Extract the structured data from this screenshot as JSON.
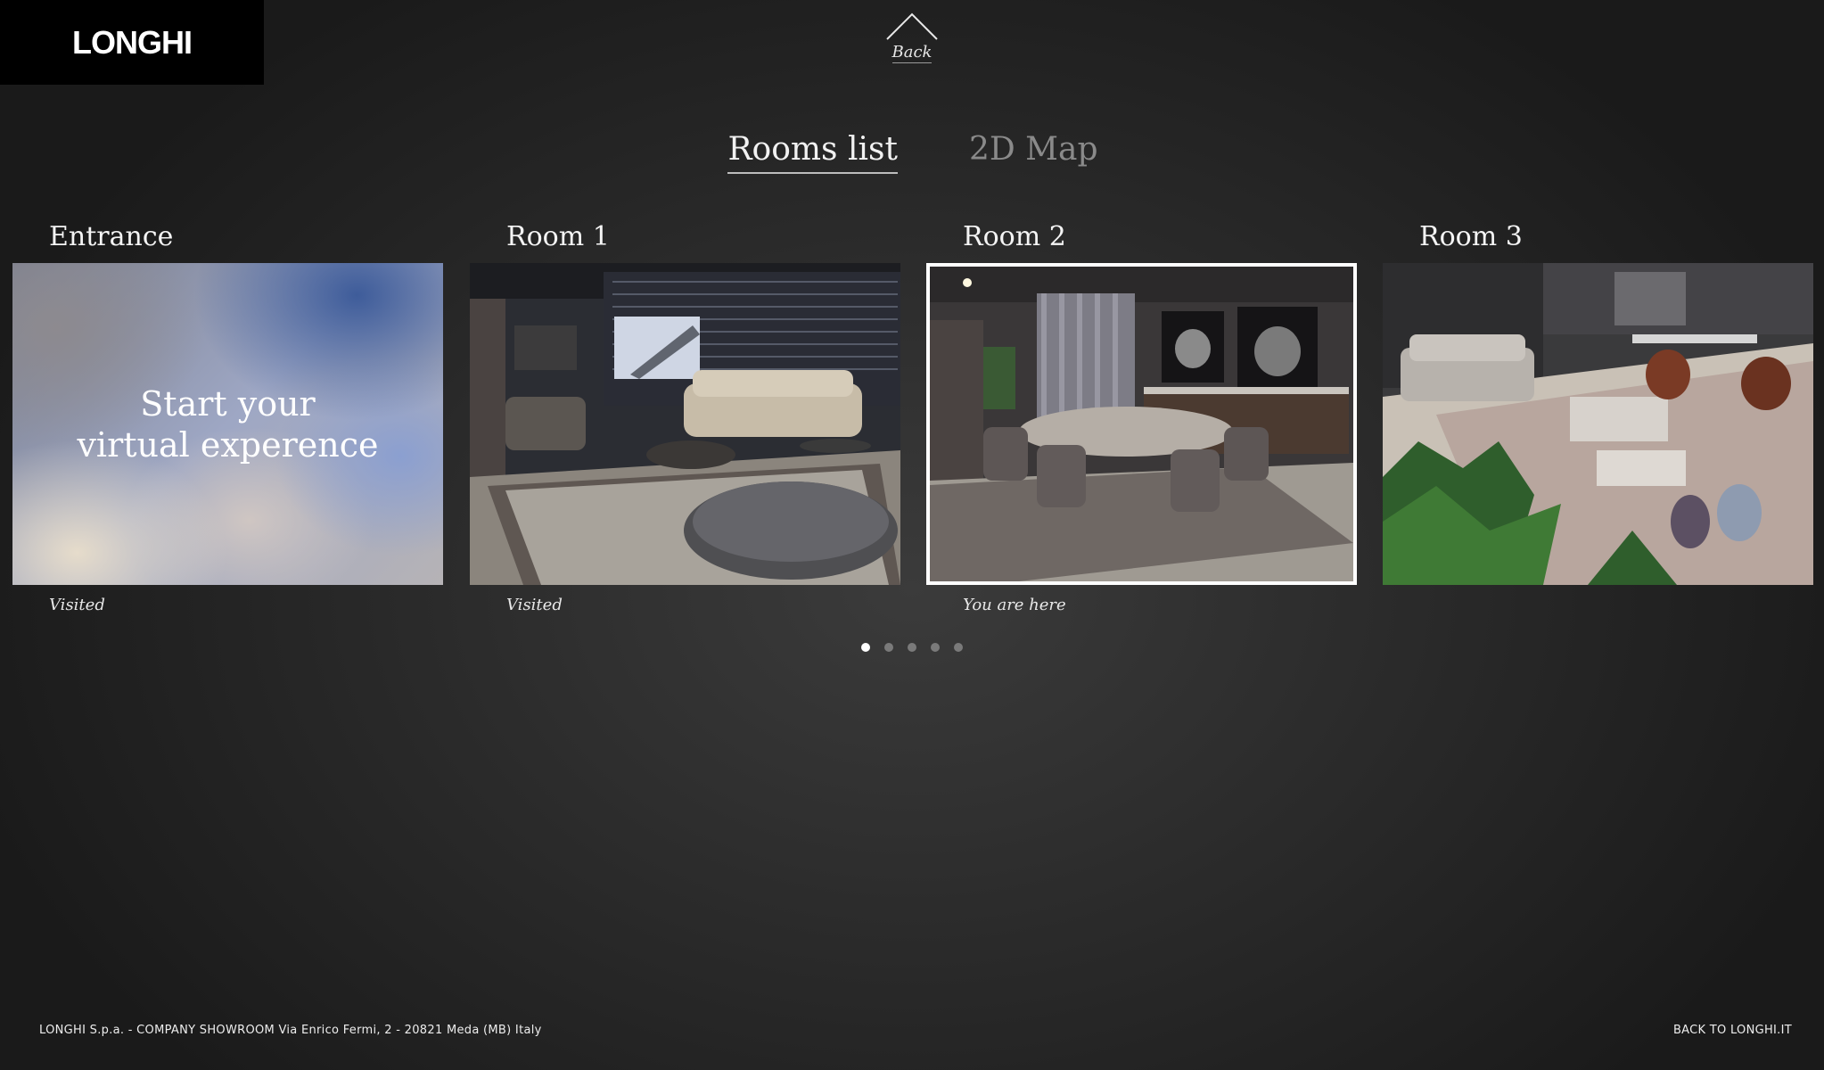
{
  "brand": {
    "logo_text": "LONGHI"
  },
  "back": {
    "label": "Back",
    "icon": "chevron-up-icon"
  },
  "tabs": [
    {
      "label": "Rooms list",
      "active": true
    },
    {
      "label": "2D Map",
      "active": false
    }
  ],
  "rooms": [
    {
      "title": "Entrance",
      "overlay_line1": "Start your",
      "overlay_line2": "virtual experence",
      "status": "Visited"
    },
    {
      "title": "Room 1",
      "status": "Visited"
    },
    {
      "title": "Room 2",
      "status": "You are here",
      "current": true
    },
    {
      "title": "Room 3",
      "status": ""
    }
  ],
  "pagination": {
    "count": 5,
    "active_index": 0
  },
  "footer": {
    "address": "LONGHI S.p.a. - COMPANY SHOWROOM Via Enrico Fermi, 2 - 20821 Meda (MB) Italy",
    "back_link": "BACK TO LONGHI.IT"
  }
}
